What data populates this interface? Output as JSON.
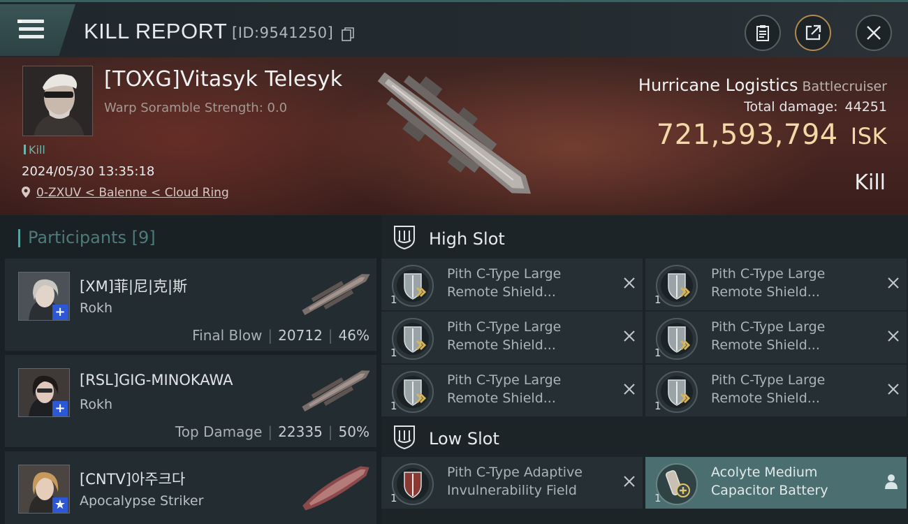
{
  "header": {
    "title": "KILL REPORT",
    "report_id": "[ID:9541250]",
    "icons": [
      "menu-icon",
      "copy-icon",
      "clipboard-icon",
      "share-icon",
      "close-icon"
    ]
  },
  "victim": {
    "name": "[TOXG]Vitasyk Telesyk",
    "warp_scramble": "Warp Soramble Strength: 0.0",
    "tag": "Kill",
    "datetime": "2024/05/30 13:35:18",
    "location": "0-ZXUV < Balenne < Cloud Ring",
    "ship_name": "Hurricane Logistics",
    "ship_class": "Battlecruiser",
    "total_damage_label": "Total damage:",
    "total_damage": "44251",
    "isk_value": "721,593,794",
    "isk_unit": "ISK",
    "result": "Kill"
  },
  "participants": {
    "label": "Participants",
    "count": "[9]",
    "rows": [
      {
        "name": "[XM]菲|尼|克|斯",
        "ship": "Rokh",
        "role": "Final Blow",
        "damage": "20712",
        "percent": "46%",
        "badge": "+"
      },
      {
        "name": "[RSL]GIG-MINOKAWA",
        "ship": "Rokh",
        "role": "Top Damage",
        "damage": "22335",
        "percent": "50%",
        "badge": "+"
      },
      {
        "name": "[CNTV]아주크다",
        "ship": "Apocalypse Striker",
        "role": "",
        "damage": "",
        "percent": "",
        "badge": "★"
      }
    ]
  },
  "fitting": {
    "high_slot_label": "High Slot",
    "low_slot_label": "Low Slot",
    "high_modules": [
      {
        "line1": "Pith C-Type Large",
        "line2": "Remote Shield...",
        "qty": "1"
      },
      {
        "line1": "Pith C-Type Large",
        "line2": "Remote Shield...",
        "qty": "1"
      },
      {
        "line1": "Pith C-Type Large",
        "line2": "Remote Shield...",
        "qty": "1"
      },
      {
        "line1": "Pith C-Type Large",
        "line2": "Remote Shield...",
        "qty": "1"
      },
      {
        "line1": "Pith C-Type Large",
        "line2": "Remote Shield...",
        "qty": "1"
      },
      {
        "line1": "Pith C-Type Large",
        "line2": "Remote Shield...",
        "qty": "1"
      }
    ],
    "low_modules": [
      {
        "line1": "Pith C-Type Adaptive",
        "line2": "Invulnerability Field",
        "qty": "1"
      },
      {
        "line1": "Acolyte Medium",
        "line2": "Capacitor Battery",
        "qty": "1"
      }
    ]
  },
  "colors": {
    "accent_teal": "#58a3a0",
    "isk_gold": "#f3d9a6",
    "badge_blue": "#2c58d6",
    "highlight_row": "#4b6e70"
  }
}
